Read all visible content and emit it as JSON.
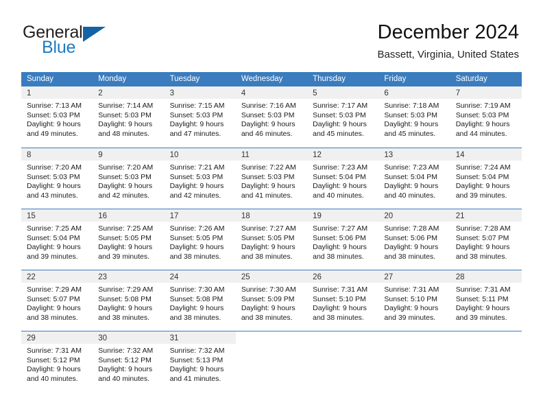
{
  "brand": {
    "name_part1": "General",
    "name_part2": "Blue",
    "accent_color": "#1f7bc1",
    "triangle_color": "#1464a5"
  },
  "header": {
    "title": "December 2024",
    "location": "Bassett, Virginia, United States"
  },
  "calendar": {
    "header_bg": "#3a7cbe",
    "weekdays": [
      "Sunday",
      "Monday",
      "Tuesday",
      "Wednesday",
      "Thursday",
      "Friday",
      "Saturday"
    ],
    "weeks": [
      [
        {
          "day": "1",
          "sunrise": "Sunrise: 7:13 AM",
          "sunset": "Sunset: 5:03 PM",
          "daylight1": "Daylight: 9 hours",
          "daylight2": "and 49 minutes."
        },
        {
          "day": "2",
          "sunrise": "Sunrise: 7:14 AM",
          "sunset": "Sunset: 5:03 PM",
          "daylight1": "Daylight: 9 hours",
          "daylight2": "and 48 minutes."
        },
        {
          "day": "3",
          "sunrise": "Sunrise: 7:15 AM",
          "sunset": "Sunset: 5:03 PM",
          "daylight1": "Daylight: 9 hours",
          "daylight2": "and 47 minutes."
        },
        {
          "day": "4",
          "sunrise": "Sunrise: 7:16 AM",
          "sunset": "Sunset: 5:03 PM",
          "daylight1": "Daylight: 9 hours",
          "daylight2": "and 46 minutes."
        },
        {
          "day": "5",
          "sunrise": "Sunrise: 7:17 AM",
          "sunset": "Sunset: 5:03 PM",
          "daylight1": "Daylight: 9 hours",
          "daylight2": "and 45 minutes."
        },
        {
          "day": "6",
          "sunrise": "Sunrise: 7:18 AM",
          "sunset": "Sunset: 5:03 PM",
          "daylight1": "Daylight: 9 hours",
          "daylight2": "and 45 minutes."
        },
        {
          "day": "7",
          "sunrise": "Sunrise: 7:19 AM",
          "sunset": "Sunset: 5:03 PM",
          "daylight1": "Daylight: 9 hours",
          "daylight2": "and 44 minutes."
        }
      ],
      [
        {
          "day": "8",
          "sunrise": "Sunrise: 7:20 AM",
          "sunset": "Sunset: 5:03 PM",
          "daylight1": "Daylight: 9 hours",
          "daylight2": "and 43 minutes."
        },
        {
          "day": "9",
          "sunrise": "Sunrise: 7:20 AM",
          "sunset": "Sunset: 5:03 PM",
          "daylight1": "Daylight: 9 hours",
          "daylight2": "and 42 minutes."
        },
        {
          "day": "10",
          "sunrise": "Sunrise: 7:21 AM",
          "sunset": "Sunset: 5:03 PM",
          "daylight1": "Daylight: 9 hours",
          "daylight2": "and 42 minutes."
        },
        {
          "day": "11",
          "sunrise": "Sunrise: 7:22 AM",
          "sunset": "Sunset: 5:03 PM",
          "daylight1": "Daylight: 9 hours",
          "daylight2": "and 41 minutes."
        },
        {
          "day": "12",
          "sunrise": "Sunrise: 7:23 AM",
          "sunset": "Sunset: 5:04 PM",
          "daylight1": "Daylight: 9 hours",
          "daylight2": "and 40 minutes."
        },
        {
          "day": "13",
          "sunrise": "Sunrise: 7:23 AM",
          "sunset": "Sunset: 5:04 PM",
          "daylight1": "Daylight: 9 hours",
          "daylight2": "and 40 minutes."
        },
        {
          "day": "14",
          "sunrise": "Sunrise: 7:24 AM",
          "sunset": "Sunset: 5:04 PM",
          "daylight1": "Daylight: 9 hours",
          "daylight2": "and 39 minutes."
        }
      ],
      [
        {
          "day": "15",
          "sunrise": "Sunrise: 7:25 AM",
          "sunset": "Sunset: 5:04 PM",
          "daylight1": "Daylight: 9 hours",
          "daylight2": "and 39 minutes."
        },
        {
          "day": "16",
          "sunrise": "Sunrise: 7:25 AM",
          "sunset": "Sunset: 5:05 PM",
          "daylight1": "Daylight: 9 hours",
          "daylight2": "and 39 minutes."
        },
        {
          "day": "17",
          "sunrise": "Sunrise: 7:26 AM",
          "sunset": "Sunset: 5:05 PM",
          "daylight1": "Daylight: 9 hours",
          "daylight2": "and 38 minutes."
        },
        {
          "day": "18",
          "sunrise": "Sunrise: 7:27 AM",
          "sunset": "Sunset: 5:05 PM",
          "daylight1": "Daylight: 9 hours",
          "daylight2": "and 38 minutes."
        },
        {
          "day": "19",
          "sunrise": "Sunrise: 7:27 AM",
          "sunset": "Sunset: 5:06 PM",
          "daylight1": "Daylight: 9 hours",
          "daylight2": "and 38 minutes."
        },
        {
          "day": "20",
          "sunrise": "Sunrise: 7:28 AM",
          "sunset": "Sunset: 5:06 PM",
          "daylight1": "Daylight: 9 hours",
          "daylight2": "and 38 minutes."
        },
        {
          "day": "21",
          "sunrise": "Sunrise: 7:28 AM",
          "sunset": "Sunset: 5:07 PM",
          "daylight1": "Daylight: 9 hours",
          "daylight2": "and 38 minutes."
        }
      ],
      [
        {
          "day": "22",
          "sunrise": "Sunrise: 7:29 AM",
          "sunset": "Sunset: 5:07 PM",
          "daylight1": "Daylight: 9 hours",
          "daylight2": "and 38 minutes."
        },
        {
          "day": "23",
          "sunrise": "Sunrise: 7:29 AM",
          "sunset": "Sunset: 5:08 PM",
          "daylight1": "Daylight: 9 hours",
          "daylight2": "and 38 minutes."
        },
        {
          "day": "24",
          "sunrise": "Sunrise: 7:30 AM",
          "sunset": "Sunset: 5:08 PM",
          "daylight1": "Daylight: 9 hours",
          "daylight2": "and 38 minutes."
        },
        {
          "day": "25",
          "sunrise": "Sunrise: 7:30 AM",
          "sunset": "Sunset: 5:09 PM",
          "daylight1": "Daylight: 9 hours",
          "daylight2": "and 38 minutes."
        },
        {
          "day": "26",
          "sunrise": "Sunrise: 7:31 AM",
          "sunset": "Sunset: 5:10 PM",
          "daylight1": "Daylight: 9 hours",
          "daylight2": "and 38 minutes."
        },
        {
          "day": "27",
          "sunrise": "Sunrise: 7:31 AM",
          "sunset": "Sunset: 5:10 PM",
          "daylight1": "Daylight: 9 hours",
          "daylight2": "and 39 minutes."
        },
        {
          "day": "28",
          "sunrise": "Sunrise: 7:31 AM",
          "sunset": "Sunset: 5:11 PM",
          "daylight1": "Daylight: 9 hours",
          "daylight2": "and 39 minutes."
        }
      ],
      [
        {
          "day": "29",
          "sunrise": "Sunrise: 7:31 AM",
          "sunset": "Sunset: 5:12 PM",
          "daylight1": "Daylight: 9 hours",
          "daylight2": "and 40 minutes."
        },
        {
          "day": "30",
          "sunrise": "Sunrise: 7:32 AM",
          "sunset": "Sunset: 5:12 PM",
          "daylight1": "Daylight: 9 hours",
          "daylight2": "and 40 minutes."
        },
        {
          "day": "31",
          "sunrise": "Sunrise: 7:32 AM",
          "sunset": "Sunset: 5:13 PM",
          "daylight1": "Daylight: 9 hours",
          "daylight2": "and 41 minutes."
        },
        {
          "day": "",
          "sunrise": "",
          "sunset": "",
          "daylight1": "",
          "daylight2": ""
        },
        {
          "day": "",
          "sunrise": "",
          "sunset": "",
          "daylight1": "",
          "daylight2": ""
        },
        {
          "day": "",
          "sunrise": "",
          "sunset": "",
          "daylight1": "",
          "daylight2": ""
        },
        {
          "day": "",
          "sunrise": "",
          "sunset": "",
          "daylight1": "",
          "daylight2": ""
        }
      ]
    ]
  }
}
